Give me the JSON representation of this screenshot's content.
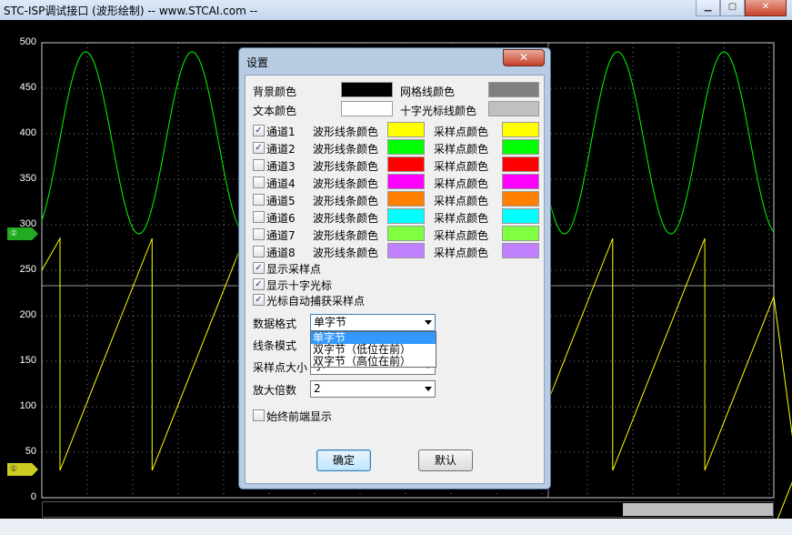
{
  "window": {
    "title": "STC-ISP调试接口 (波形绘制) -- www.STCAI.com --",
    "minimize_icon": "minimize-icon",
    "maximize_icon": "maximize-icon",
    "close_label": "✕"
  },
  "scope": {
    "y_ticks": [
      "500",
      "450",
      "400",
      "350",
      "300",
      "250",
      "200",
      "150",
      "100",
      "50",
      "0"
    ],
    "channel_markers": [
      "②",
      "①"
    ],
    "colors": {
      "background": "#000000",
      "grid": "#808080",
      "ch1": "#ffff00",
      "ch2": "#00ff00",
      "crosshair": "#c0c0c0"
    },
    "scroll_position": 0.79
  },
  "dialog": {
    "title": "设置",
    "close_label": "✕",
    "bg_color_label": "背景颜色",
    "grid_color_label": "网格线颜色",
    "text_color_label": "文本颜色",
    "crosshair_color_label": "十字光标线颜色",
    "bg_color": "#000000",
    "grid_color": "#808080",
    "text_color": "#ffffff",
    "crosshair_color": "#c0c0c0",
    "channels": [
      {
        "label": "通道1",
        "checked": true,
        "wave_label": "波形线条颜色",
        "sample_label": "采样点颜色",
        "color": "#ffff00"
      },
      {
        "label": "通道2",
        "checked": true,
        "wave_label": "波形线条颜色",
        "sample_label": "采样点颜色",
        "color": "#00ff00"
      },
      {
        "label": "通道3",
        "checked": false,
        "wave_label": "波形线条颜色",
        "sample_label": "采样点颜色",
        "color": "#ff0000"
      },
      {
        "label": "通道4",
        "checked": false,
        "wave_label": "波形线条颜色",
        "sample_label": "采样点颜色",
        "color": "#ff00ff"
      },
      {
        "label": "通道5",
        "checked": false,
        "wave_label": "波形线条颜色",
        "sample_label": "采样点颜色",
        "color": "#ff8000"
      },
      {
        "label": "通道6",
        "checked": false,
        "wave_label": "波形线条颜色",
        "sample_label": "采样点颜色",
        "color": "#00ffff"
      },
      {
        "label": "通道7",
        "checked": false,
        "wave_label": "波形线条颜色",
        "sample_label": "采样点颜色",
        "color": "#80ff40"
      },
      {
        "label": "通道8",
        "checked": false,
        "wave_label": "波形线条颜色",
        "sample_label": "采样点颜色",
        "color": "#c080ff"
      }
    ],
    "show_samples": {
      "label": "显示采样点",
      "checked": true
    },
    "show_crosshair": {
      "label": "显示十字光标",
      "checked": true
    },
    "auto_capture": {
      "label": "光标自动捕获采样点",
      "checked": true
    },
    "data_format_label": "数据格式",
    "data_format_value": "单字节",
    "data_format_options": [
      "单字节",
      "双字节（低位在前）",
      "双字节（高位在前）"
    ],
    "line_mode_label": "线条模式",
    "sample_size_label": "采样点大小",
    "sample_size_value": "小",
    "zoom_label": "放大倍数",
    "zoom_value": "2",
    "always_on_top": {
      "label": "始终前端显示",
      "checked": false
    },
    "ok_label": "确定",
    "default_label": "默认"
  }
}
